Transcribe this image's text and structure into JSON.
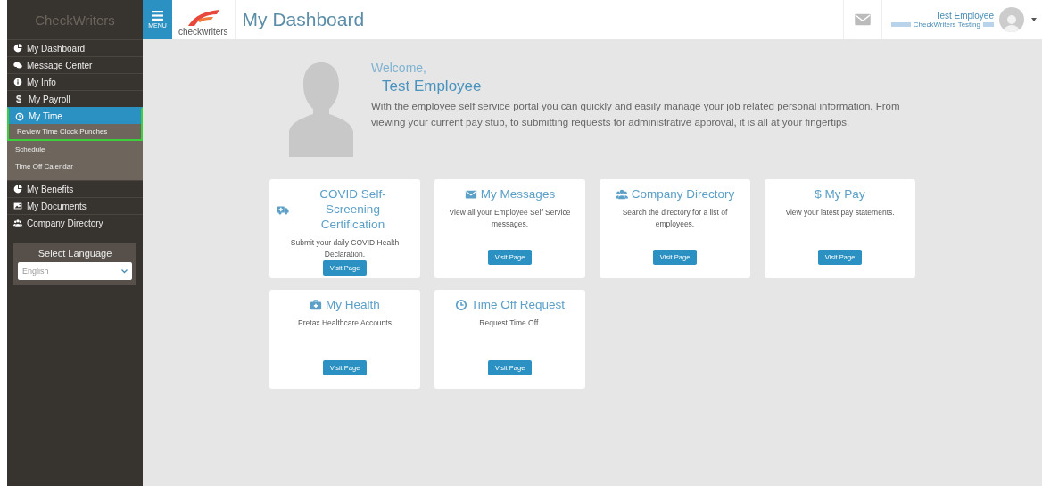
{
  "sidebar": {
    "brand": "CheckWriters",
    "items": [
      {
        "label": "My Dashboard",
        "kind": "pie",
        "selected": false,
        "highlighted": false
      },
      {
        "label": "Message Center",
        "kind": "chat",
        "selected": false,
        "highlighted": false
      },
      {
        "label": "My Info",
        "kind": "info",
        "selected": false,
        "highlighted": false
      },
      {
        "label": "My Payroll",
        "icon_text": "$",
        "selected": false,
        "highlighted": false
      },
      {
        "label": "My Time",
        "kind": "clock",
        "selected": true,
        "highlighted": true,
        "expanded": true,
        "children": [
          {
            "label": "Review Time Clock Punches",
            "highlighted": true
          },
          {
            "label": "Schedule",
            "highlighted": false
          },
          {
            "label": "Time Off Calendar",
            "highlighted": false
          }
        ]
      },
      {
        "label": "My Benefits",
        "kind": "pie",
        "selected": false,
        "highlighted": false
      },
      {
        "label": "My Documents",
        "kind": "image",
        "selected": false,
        "highlighted": false
      },
      {
        "label": "Company Directory",
        "kind": "users",
        "selected": false,
        "highlighted": false
      }
    ],
    "language": {
      "label": "Select Language",
      "value": "English"
    }
  },
  "header": {
    "menu_label": "MENU",
    "logo_text": "checkwriters",
    "title": "My Dashboard",
    "user": {
      "name": "Test Employee",
      "company": "CheckWriters Testing"
    }
  },
  "welcome": {
    "greeting": "Welcome,",
    "name": "Test Employee",
    "text": "With the employee self service portal you can quickly and easily manage your job related personal information. From viewing your current pay stub, to submitting requests for administrative approval, it is all at your fingertips."
  },
  "cards": [
    {
      "title": "COVID Self-Screening Certification",
      "kind": "ambulance",
      "description": "Submit your daily COVID Health Declaration.",
      "button": "Visit Page"
    },
    {
      "title": "My Messages",
      "kind": "envelope",
      "description": "View all your Employee Self Service messages.",
      "button": "Visit Page"
    },
    {
      "title": "Company Directory",
      "kind": "users",
      "description": "Search the directory for a list of employees.",
      "button": "Visit Page"
    },
    {
      "title": "$ My Pay",
      "description": "View your latest pay statements.",
      "button": "Visit Page"
    },
    {
      "title": "My Health",
      "kind": "medkit",
      "description": "Pretax Healthcare Accounts",
      "button": "Visit Page"
    },
    {
      "title": "Time Off Request",
      "kind": "clock",
      "description": "Request Time Off.",
      "button": "Visit Page"
    }
  ]
}
